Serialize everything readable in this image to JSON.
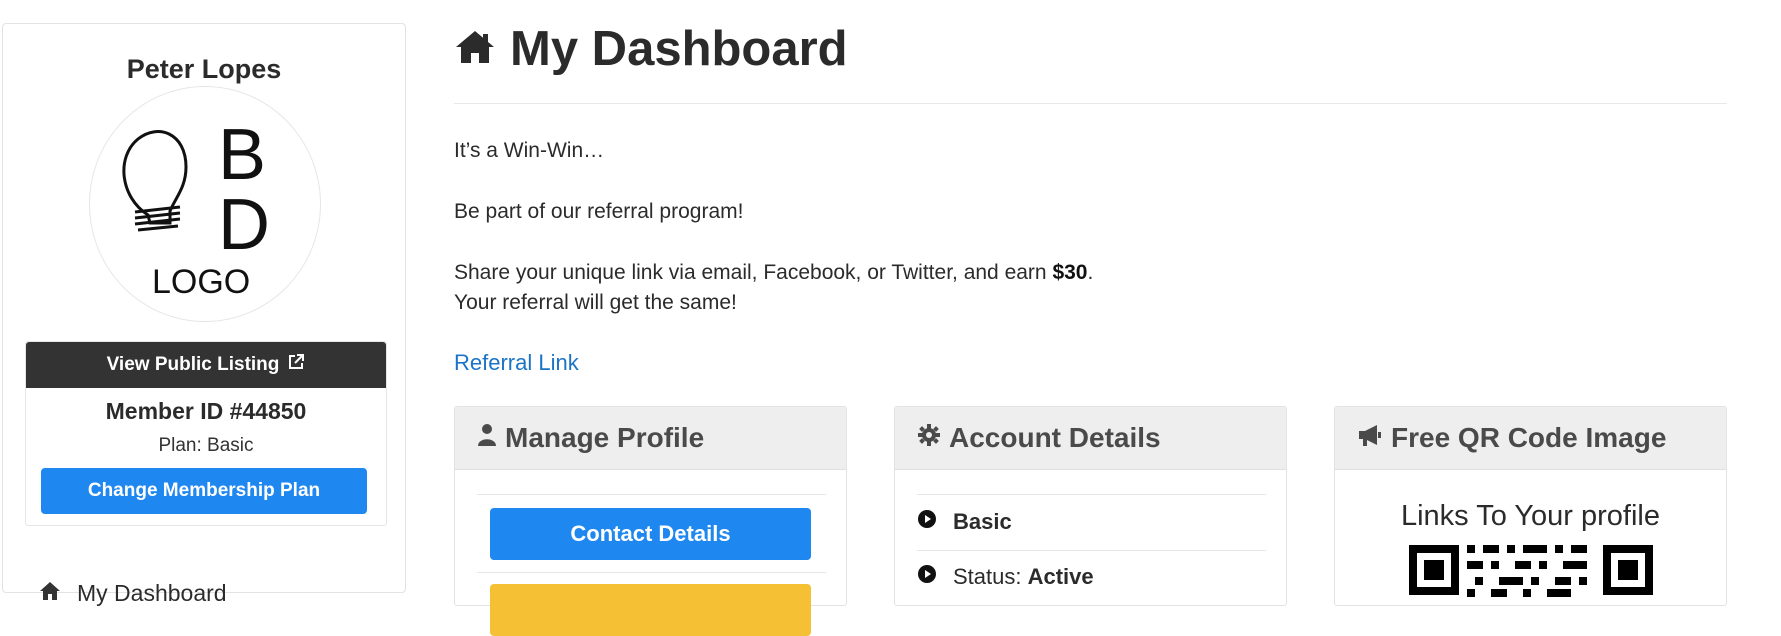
{
  "sidebar": {
    "member_name": "Peter Lopes",
    "logo": {
      "letters_top": "B",
      "letters_bottom": "D",
      "word": "LOGO"
    },
    "view_listing_label": "View Public Listing",
    "member_id": "Member ID #44850",
    "plan": "Plan: Basic",
    "change_plan_label": "Change Membership Plan",
    "nav": [
      {
        "label": "My Dashboard",
        "icon": "home-icon"
      }
    ]
  },
  "main": {
    "title": "My Dashboard",
    "intro": [
      "It’s a Win-Win…",
      "Be part of our referral program!",
      "Share your unique link via email, Facebook, or Twitter, and earn ",
      "$30",
      ".",
      "Your referral will get the same!"
    ],
    "referral_link_label": "Referral Link",
    "cards": {
      "manage_profile": {
        "title": "Manage Profile",
        "icon": "user-icon",
        "button_label": "Contact Details"
      },
      "account_details": {
        "title": "Account Details",
        "icon": "gear-icon",
        "plan_value": "Basic",
        "status_label": "Status:",
        "status_value": "Active"
      },
      "qr": {
        "title": "Free QR Code Image",
        "icon": "megaphone-icon",
        "caption": "Links To Your profile"
      }
    }
  },
  "colors": {
    "primary": "#1f87f0",
    "dark": "#333333",
    "link": "#1c74c7",
    "warning": "#f5c033",
    "card_header": "#eeeeee"
  }
}
